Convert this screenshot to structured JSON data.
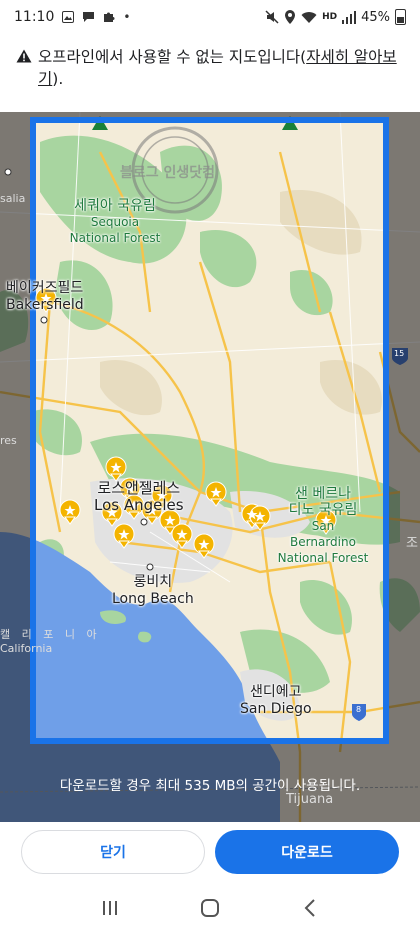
{
  "status_bar": {
    "time": "11:10",
    "battery": "45%",
    "network": "HD"
  },
  "warning": {
    "message": "오프라인에서 사용할 수 없는 지도입니다(",
    "link": "자세히 알아보기",
    "suffix": ")."
  },
  "map": {
    "labels": {
      "sequoia_ko": "세쿼아 국유림",
      "sequoia_en1": "Sequoia",
      "sequoia_en2": "National Forest",
      "bakersfield_ko": "베이커즈필드",
      "bakersfield_en": "Bakersfield",
      "la_ko": "로스앤젤레스",
      "la_en": "Los Angeles",
      "sb_ko1": "샌 베르나",
      "sb_ko2": "디노 국유림",
      "sb_en1": "San",
      "sb_en2": "Bernardino",
      "sb_en3": "National Forest",
      "longbeach_ko": "롱비치",
      "longbeach_en": "Long Beach",
      "sandiego_ko": "샌디에고",
      "sandiego_en": "San Diego",
      "california_ko": "캘 리 포 니 아",
      "california_en": "California",
      "tijuana": "Tijuana",
      "salia": "salia",
      "res": "res",
      "jo": "조"
    },
    "highway_shields": [
      "15",
      "8"
    ],
    "watermark": "블로그 인생닷컴"
  },
  "download_info": "다운로드할 경우 최대 535 MB의 공간이 사용됩니다.",
  "buttons": {
    "close": "닫기",
    "download": "다운로드"
  },
  "colors": {
    "accent": "#1a73e8",
    "land": "#f3ecd9",
    "forest": "#a8d5a0",
    "water": "#6f9fe8",
    "road": "#f6c34a",
    "pin": "#f4b400"
  }
}
